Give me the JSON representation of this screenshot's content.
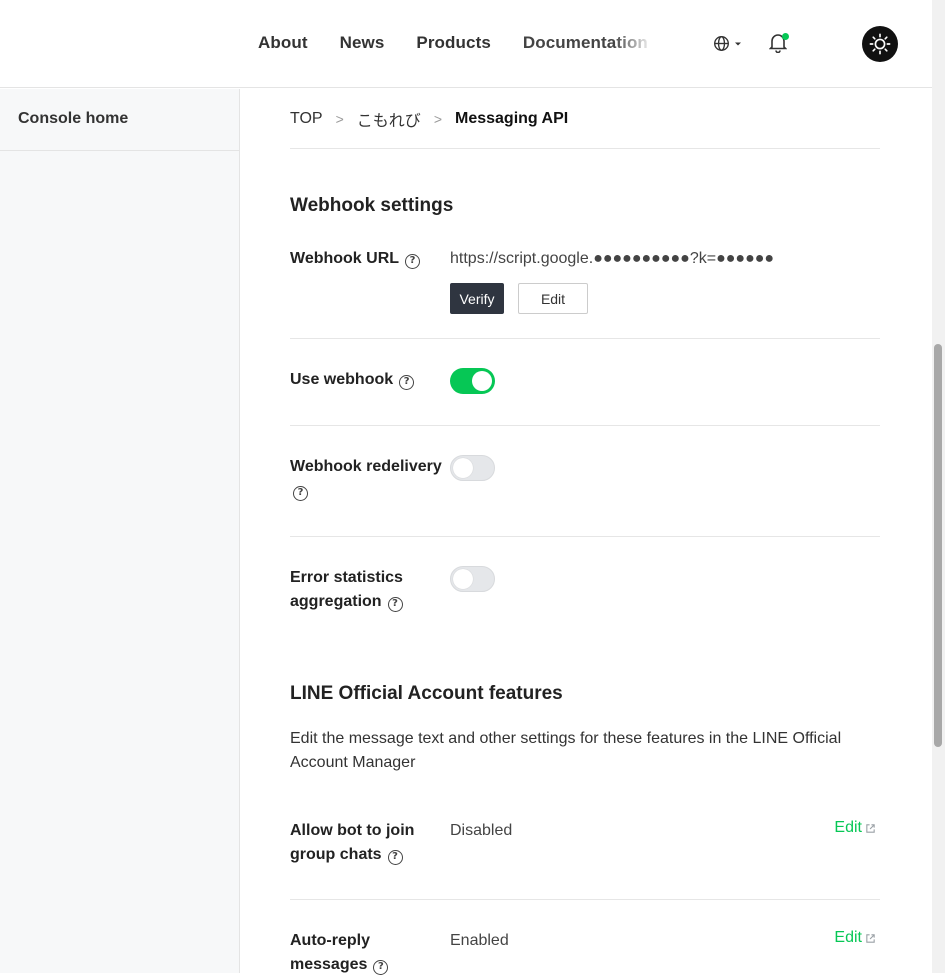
{
  "nav": {
    "items": [
      "About",
      "News",
      "Products",
      "Documentation"
    ]
  },
  "sidebar": {
    "items": [
      {
        "label": "Console home"
      }
    ]
  },
  "breadcrumb": {
    "items": [
      "TOP",
      "こもれび",
      "Messaging API"
    ],
    "sep": ">"
  },
  "webhook": {
    "title": "Webhook settings",
    "url_label": "Webhook URL",
    "url_value": "https://script.google.●●●●●●●●●●?k=●●●●●●",
    "verify_label": "Verify",
    "edit_label": "Edit",
    "use_label": "Use webhook",
    "use_enabled": true,
    "redelivery_label": "Webhook redelivery",
    "redelivery_enabled": false,
    "error_label_1": "Error statistics",
    "error_label_2": "aggregation",
    "error_enabled": false
  },
  "features": {
    "title": "LINE Official Account features",
    "description": "Edit the message text and other settings for these features in the LINE Official Account Manager",
    "items": [
      {
        "label_1": "Allow bot to join",
        "label_2": "group chats",
        "value": "Disabled",
        "edit": "Edit"
      },
      {
        "label_1": "Auto-reply",
        "label_2": "messages",
        "value": "Enabled",
        "edit": "Edit"
      }
    ]
  },
  "help_glyph": "?",
  "colors": {
    "accent": "#06c755",
    "dark_button": "#2f3540"
  }
}
